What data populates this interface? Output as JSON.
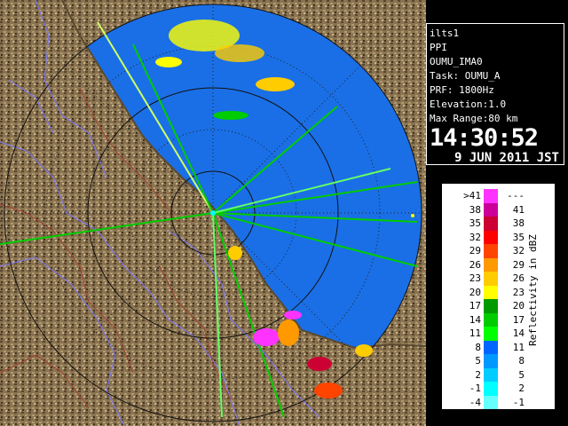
{
  "info": {
    "lines": [
      "ilts1",
      "PPI",
      "OUMU_IMA0",
      "Task: OUMU_A",
      "PRF: 1800Hz",
      "Elevation:1.0",
      "Max Range:80 km"
    ],
    "time": "14:30:52",
    "date": "9 JUN 2011 JST"
  },
  "legend": {
    "title": "Reflectivity in dBZ",
    "rows": [
      {
        "lo": ">41",
        "hi": "---",
        "color": "#ff33ff"
      },
      {
        "lo": "38",
        "hi": "41",
        "color": "#cc0099"
      },
      {
        "lo": "35",
        "hi": "38",
        "color": "#cc0033"
      },
      {
        "lo": "32",
        "hi": "35",
        "color": "#ff0000"
      },
      {
        "lo": "29",
        "hi": "32",
        "color": "#ff4400"
      },
      {
        "lo": "26",
        "hi": "29",
        "color": "#ff9900"
      },
      {
        "lo": "23",
        "hi": "26",
        "color": "#ffcc00"
      },
      {
        "lo": "20",
        "hi": "23",
        "color": "#ffff00"
      },
      {
        "lo": "17",
        "hi": "20",
        "color": "#009900"
      },
      {
        "lo": "14",
        "hi": "17",
        "color": "#00cc00"
      },
      {
        "lo": "11",
        "hi": "14",
        "color": "#00ff00"
      },
      {
        "lo": "8",
        "hi": "11",
        "color": "#0066ff"
      },
      {
        "lo": "5",
        "hi": "8",
        "color": "#0099ff"
      },
      {
        "lo": "2",
        "hi": "5",
        "color": "#00ccff"
      },
      {
        "lo": "-1",
        "hi": "2",
        "color": "#00ffff"
      },
      {
        "lo": "-4",
        "hi": "-1",
        "color": "#66ffff"
      }
    ]
  },
  "map_colors": {
    "sea": "#1a6fe6",
    "sea_dark": "#0a40c8",
    "land": "#7d6848",
    "border": "#7b79ff",
    "river": "#a04030",
    "ring": "#1a1a1a"
  }
}
